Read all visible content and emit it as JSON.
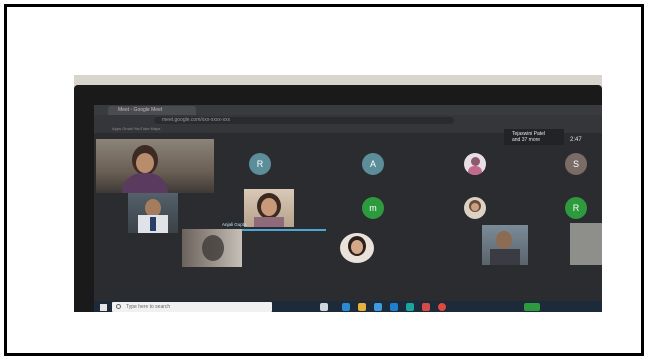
{
  "browser": {
    "tab_title": "Meet - Google Meet",
    "address": "meet.google.com/xxx-xxxx-xxx",
    "bookmarks": "Apps   Gmail   YouTube   Maps"
  },
  "presenter_tag": {
    "line1": "Tejaswini Patel",
    "line2": "and 37 more"
  },
  "clock": "2:47",
  "speaking_label": "Anjali Gupta",
  "avatars": {
    "r1": "R",
    "a1": "A",
    "s1": "S",
    "m1": "m",
    "r2": "R"
  },
  "taskbar": {
    "search_placeholder": "Type here to search"
  },
  "colors": {
    "avatar_teal": "#5b8e99",
    "avatar_green": "#2e9a3e",
    "avatar_grey": "#7a6c66",
    "speaking": "#4ea6d6"
  }
}
